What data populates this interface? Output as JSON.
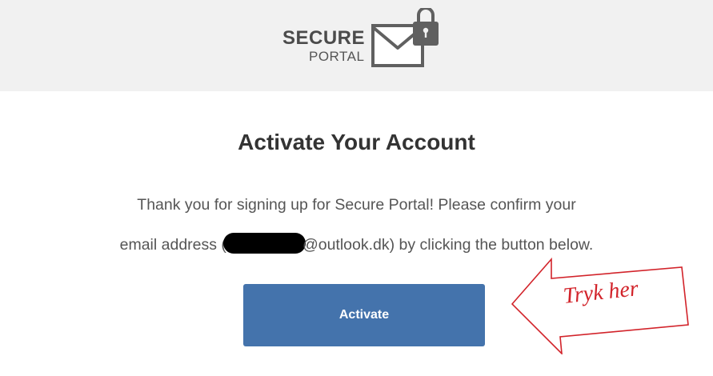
{
  "header": {
    "logo_primary": "SECURE",
    "logo_secondary": "PORTAL"
  },
  "main": {
    "title": "Activate Your Account",
    "message_line1": "Thank you for signing up for Secure Portal! Please confirm your",
    "message_line2_prefix": "email address (",
    "message_line2_email_domain": "@outlook.dk) by clicking the button below.",
    "button_label": "Activate"
  },
  "annotation": {
    "text": "Tryk her",
    "color": "#d2232a"
  },
  "colors": {
    "header_bg": "#f1f1f1",
    "button_bg": "#4473ac",
    "title_text": "#333333",
    "body_text": "#555555",
    "logo_gray": "#4b4b4b"
  }
}
